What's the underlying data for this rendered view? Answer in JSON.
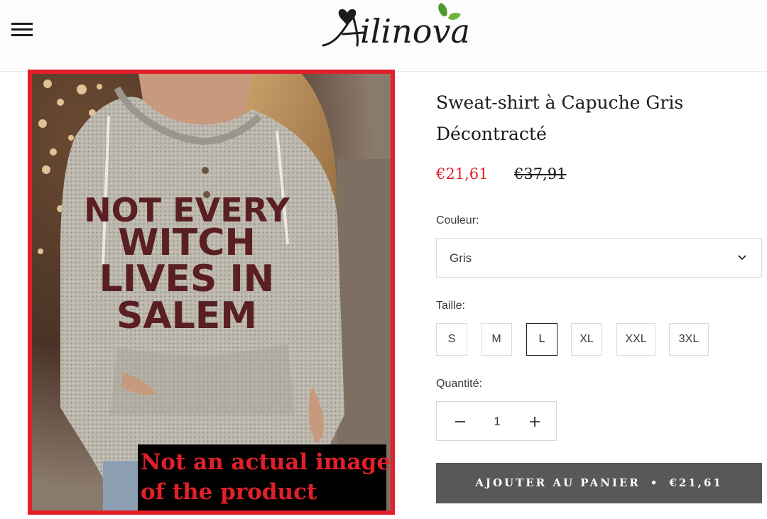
{
  "header": {
    "menu_icon": "hamburger-menu-icon",
    "logo_text": "Ailinova"
  },
  "product_image": {
    "shirt_text": [
      "NOT EVERY",
      "WITCH",
      "LIVES IN",
      "SALEM"
    ],
    "disclaimer_lines": [
      "Not an actual image",
      "of the product"
    ]
  },
  "product": {
    "title": "Sweat-shirt à Capuche Gris Décontracté",
    "price_sale": "€21,61",
    "price_old": "€37,91"
  },
  "options": {
    "color_label": "Couleur:",
    "color_value": "Gris",
    "size_label": "Taille:",
    "sizes": [
      "S",
      "M",
      "L",
      "XL",
      "XXL",
      "3XL"
    ],
    "selected_size": "L",
    "quantity_label": "Quantité:",
    "quantity": "1"
  },
  "cart": {
    "label": "AJOUTER AU PANIER",
    "separator": "•",
    "price": "€21,61"
  },
  "colors": {
    "accent_red": "#e2202a",
    "button_gray": "#585858",
    "logo_green": "#4f9a2c"
  }
}
